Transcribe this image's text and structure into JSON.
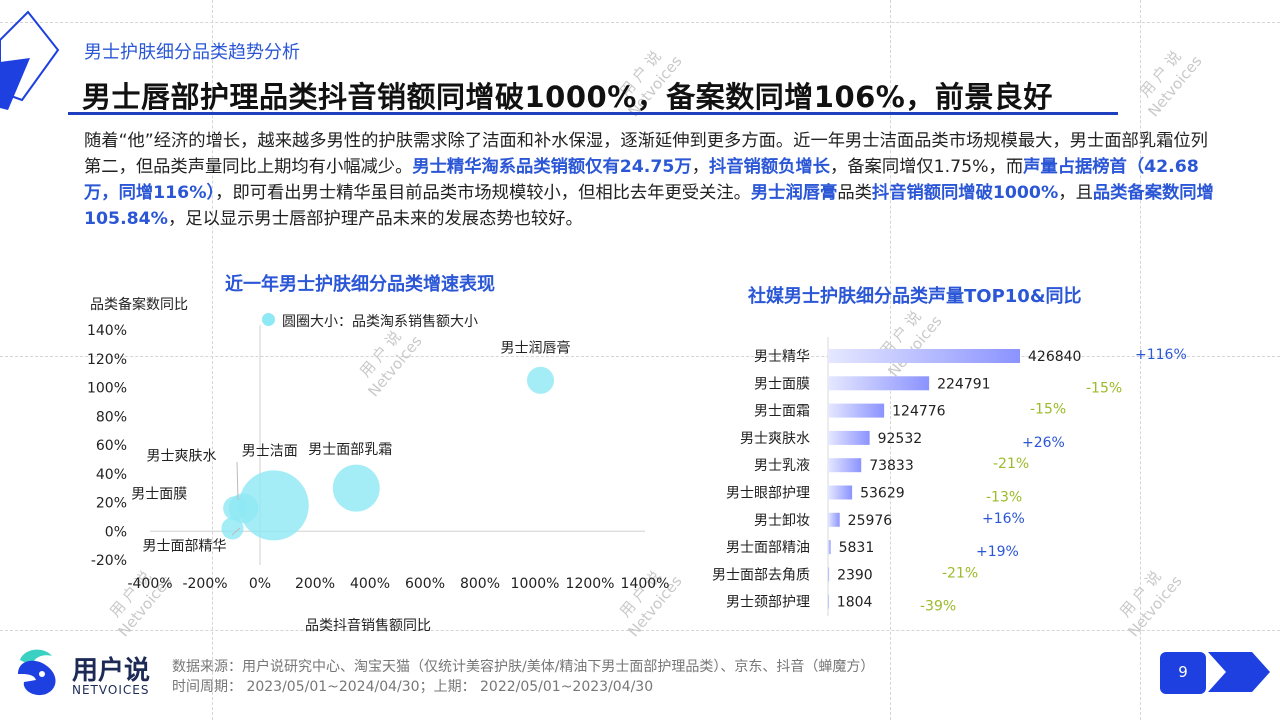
{
  "section_tag": "男士护肤细分品类趋势分析",
  "title": "男士唇部护理品类抖音销额同增破1000%，备案数同增106%，前景良好",
  "paragraph": [
    {
      "t": "随着“他”经济的增长，越来越多男性的护肤需求除了洁面和补水保湿，逐渐延伸到更多方面。近一年男士洁面品类市场规模最大，男士面部乳霜位列第二，但品类声量同比上期均有小幅减少。",
      "h": false
    },
    {
      "t": "男士精华淘系品类销额仅有24.75万",
      "h": true
    },
    {
      "t": "，",
      "h": false
    },
    {
      "t": "抖音销额负增长",
      "h": true
    },
    {
      "t": "，备案同增仅1.75%，而",
      "h": false
    },
    {
      "t": "声量占据榜首（42.68万，同增116%）",
      "h": true
    },
    {
      "t": "，即可看出男士精华虽目前品类市场规模较小，但相比去年更受关注。",
      "h": false
    },
    {
      "t": "男士润唇膏",
      "h": true
    },
    {
      "t": "品类",
      "h": false
    },
    {
      "t": "抖音销额同增破1000%",
      "h": true
    },
    {
      "t": "，且",
      "h": false
    },
    {
      "t": "品类备案数同增105.84%",
      "h": true
    },
    {
      "t": "，足以显示男士唇部护理产品未来的发展态势也较好。",
      "h": false
    }
  ],
  "bubble_chart": {
    "title": "近一年男士护肤细分品类增速表现",
    "ylabel": "品类备案数同比",
    "xlabel": "品类抖音销售额同比",
    "legend": "圆圈大小：品类淘系销售额大小",
    "x_ticks": [
      "-400%",
      "-200%",
      "0%",
      "200%",
      "400%",
      "600%",
      "800%",
      "1000%",
      "1200%",
      "1400%"
    ],
    "y_ticks": [
      "140%",
      "120%",
      "100%",
      "80%",
      "60%",
      "40%",
      "20%",
      "0%",
      "-20%"
    ]
  },
  "bar_chart": {
    "title": "社媒男士护肤细分品类声量TOP10&同比"
  },
  "chart_data": [
    {
      "type": "scatter",
      "title": "近一年男士护肤细分品类增速表现",
      "xlabel": "品类抖音销售额同比",
      "ylabel": "品类备案数同比",
      "xlim": [
        -400,
        1400
      ],
      "ylim": [
        -20,
        140
      ],
      "points": [
        {
          "name": "男士润唇膏",
          "x": 1020,
          "y": 105,
          "size": 0.15
        },
        {
          "name": "男士面部乳霜",
          "x": 350,
          "y": 30,
          "size": 0.45
        },
        {
          "name": "男士洁面",
          "x": 50,
          "y": 18,
          "size": 1.0
        },
        {
          "name": "男士爽肤水",
          "x": -60,
          "y": 16,
          "size": 0.18
        },
        {
          "name": "男士面膜",
          "x": -90,
          "y": 16,
          "size": 0.12
        },
        {
          "name": "男士面部精华",
          "x": -100,
          "y": 2,
          "size": 0.1
        }
      ]
    },
    {
      "type": "bar",
      "title": "社媒男士护肤细分品类声量TOP10&同比",
      "categories": [
        "男士精华",
        "男士面膜",
        "男士面霜",
        "男士爽肤水",
        "男士乳液",
        "男士眼部护理",
        "男士卸妆",
        "男士面部精油",
        "男士面部去角质",
        "男士颈部护理"
      ],
      "values": [
        426840,
        224791,
        124776,
        92532,
        73833,
        53629,
        25976,
        5831,
        2390,
        1804
      ],
      "yoy": [
        "+116%",
        "-15%",
        "-15%",
        "+26%",
        "-21%",
        "-13%",
        "+16%",
        "+19%",
        "-21%",
        "-39%"
      ],
      "colors": {
        "bar": "#8b93ff",
        "positive": "#2b57d6",
        "negative": "#9bbb2a"
      }
    }
  ],
  "footer": {
    "source": "数据来源：用户说研究中心、淘宝天猫（仅统计美容护肤/美体/精油下男士面部护理品类）、京东、抖音（蝉魔方）",
    "period": "时间周期：  2023/05/01~2024/04/30；上期：  2022/05/01~2023/04/30",
    "brand": "用户说",
    "brand_sub": "NETVOICES",
    "page": "9"
  },
  "watermark": {
    "line1": "用 户 说",
    "line2": "Netvoices"
  }
}
